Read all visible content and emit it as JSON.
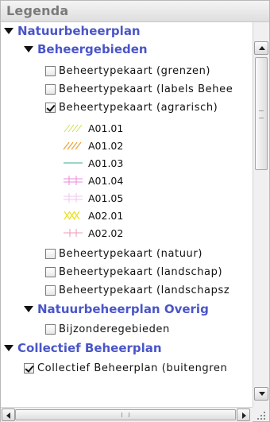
{
  "panel": {
    "title": "Legenda"
  },
  "tree": {
    "natuurbeheerplan": "Natuurbeheerplan",
    "beheergebieden": "Beheergebieden",
    "layers_top": [
      {
        "label": "Beheertypekaart (grenzen)",
        "checked": false
      },
      {
        "label": "Beheertypekaart (labels Behee",
        "checked": false
      },
      {
        "label": "Beheertypekaart (agrarisch)",
        "checked": true
      }
    ],
    "legend_items": [
      {
        "label": "A01.01",
        "symbol": "diagonal-hatch-yellow-green"
      },
      {
        "label": "A01.02",
        "symbol": "diagonal-hatch-orange"
      },
      {
        "label": "A01.03",
        "symbol": "line-teal"
      },
      {
        "label": "A01.04",
        "symbol": "grid-pink"
      },
      {
        "label": "A01.05",
        "symbol": "grid-light-pink"
      },
      {
        "label": "A02.01",
        "symbol": "crosshatch-yellow"
      },
      {
        "label": "A02.02",
        "symbol": "cross-pink"
      }
    ],
    "layers_bottom": [
      {
        "label": "Beheertypekaart (natuur)",
        "checked": false
      },
      {
        "label": "Beheertypekaart (landschap)",
        "checked": false
      },
      {
        "label": "Beheertypekaart (landschapsz",
        "checked": false
      }
    ],
    "overig": "Natuurbeheerplan Overig",
    "overig_layers": [
      {
        "label": "Bijzonderegebieden",
        "checked": false
      }
    ],
    "collectief": "Collectief Beheerplan",
    "collectief_layers": [
      {
        "label": "Collectief Beheerplan (buitengren",
        "checked": true
      }
    ]
  },
  "colors": {
    "group": "#4a55c8",
    "text": "#111111",
    "header_text": "#7a7a7a"
  }
}
